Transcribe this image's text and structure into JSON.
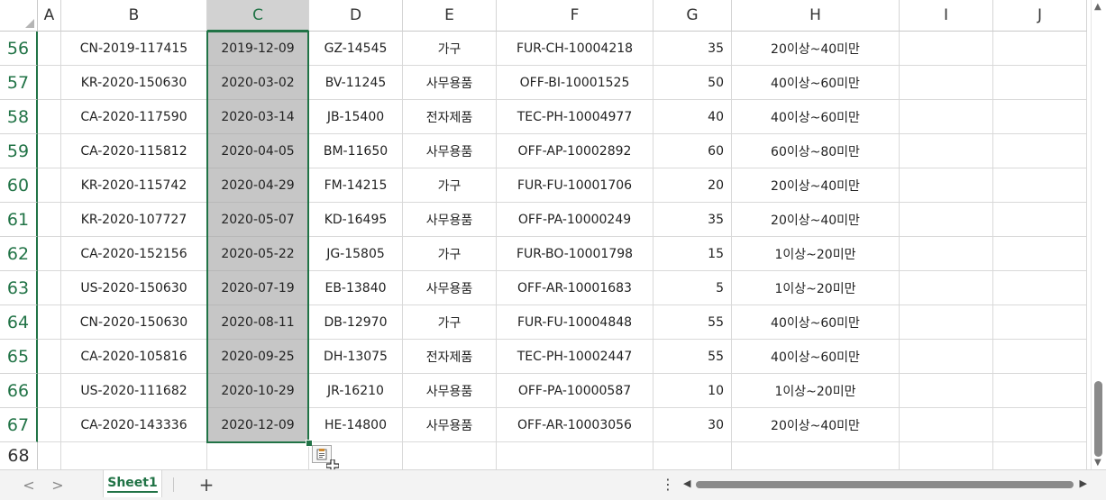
{
  "columns": [
    "A",
    "B",
    "C",
    "D",
    "E",
    "F",
    "G",
    "H",
    "I",
    "J"
  ],
  "selected_column": "C",
  "rows": [
    {
      "num": "56",
      "b": "CN-2019-117415",
      "c": "2019-12-09",
      "d": "GZ-14545",
      "e": "가구",
      "f": "FUR-CH-10004218",
      "g": "35",
      "h": "20이상~40미만"
    },
    {
      "num": "57",
      "b": "KR-2020-150630",
      "c": "2020-03-02",
      "d": "BV-11245",
      "e": "사무용품",
      "f": "OFF-BI-10001525",
      "g": "50",
      "h": "40이상~60미만"
    },
    {
      "num": "58",
      "b": "CA-2020-117590",
      "c": "2020-03-14",
      "d": "JB-15400",
      "e": "전자제품",
      "f": "TEC-PH-10004977",
      "g": "40",
      "h": "40이상~60미만"
    },
    {
      "num": "59",
      "b": "CA-2020-115812",
      "c": "2020-04-05",
      "d": "BM-11650",
      "e": "사무용품",
      "f": "OFF-AP-10002892",
      "g": "60",
      "h": "60이상~80미만"
    },
    {
      "num": "60",
      "b": "KR-2020-115742",
      "c": "2020-04-29",
      "d": "FM-14215",
      "e": "가구",
      "f": "FUR-FU-10001706",
      "g": "20",
      "h": "20이상~40미만"
    },
    {
      "num": "61",
      "b": "KR-2020-107727",
      "c": "2020-05-07",
      "d": "KD-16495",
      "e": "사무용품",
      "f": "OFF-PA-10000249",
      "g": "35",
      "h": "20이상~40미만"
    },
    {
      "num": "62",
      "b": "CA-2020-152156",
      "c": "2020-05-22",
      "d": "JG-15805",
      "e": "가구",
      "f": "FUR-BO-10001798",
      "g": "15",
      "h": "1이상~20미만"
    },
    {
      "num": "63",
      "b": "US-2020-150630",
      "c": "2020-07-19",
      "d": "EB-13840",
      "e": "사무용품",
      "f": "OFF-AR-10001683",
      "g": "5",
      "h": "1이상~20미만"
    },
    {
      "num": "64",
      "b": "CN-2020-150630",
      "c": "2020-08-11",
      "d": "DB-12970",
      "e": "가구",
      "f": "FUR-FU-10004848",
      "g": "55",
      "h": "40이상~60미만"
    },
    {
      "num": "65",
      "b": "CA-2020-105816",
      "c": "2020-09-25",
      "d": "DH-13075",
      "e": "전자제품",
      "f": "TEC-PH-10002447",
      "g": "55",
      "h": "40이상~60미만"
    },
    {
      "num": "66",
      "b": "US-2020-111682",
      "c": "2020-10-29",
      "d": "JR-16210",
      "e": "사무용품",
      "f": "OFF-PA-10000587",
      "g": "10",
      "h": "1이상~20미만"
    },
    {
      "num": "67",
      "b": "CA-2020-143336",
      "c": "2020-12-09",
      "d": "HE-14800",
      "e": "사무용품",
      "f": "OFF-AR-10003056",
      "g": "30",
      "h": "20이상~40미만"
    }
  ],
  "empty_row": "68",
  "sheet_tab": "Sheet1",
  "add_sheet": "+",
  "tab_menu": "⋮",
  "nav_prev": "<",
  "nav_next": ">",
  "colors": {
    "accent": "#217346",
    "selection": "#c6c6c6"
  }
}
